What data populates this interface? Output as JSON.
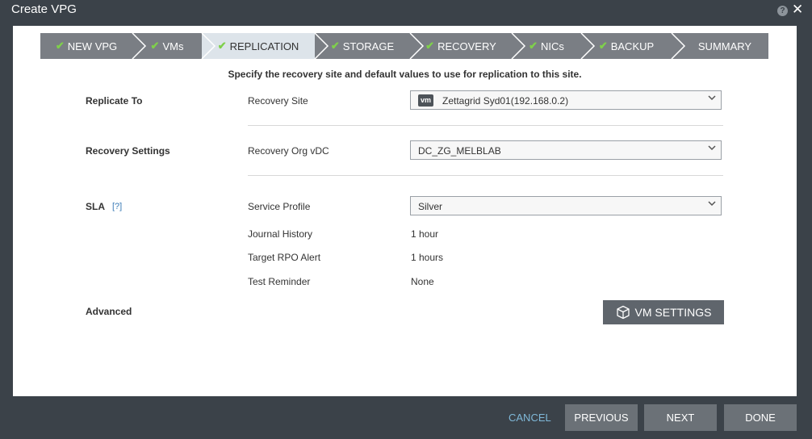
{
  "window": {
    "title": "Create VPG"
  },
  "wizard": {
    "steps": [
      {
        "label": "NEW VPG",
        "check": "✔"
      },
      {
        "label": "VMs",
        "check": "✔"
      },
      {
        "label": "REPLICATION",
        "check": "✔"
      },
      {
        "label": "STORAGE",
        "check": "✔"
      },
      {
        "label": "RECOVERY",
        "check": "✔"
      },
      {
        "label": "NICs",
        "check": "✔"
      },
      {
        "label": "BACKUP",
        "check": "✔"
      },
      {
        "label": "SUMMARY",
        "check": ""
      }
    ],
    "active_step": "REPLICATION"
  },
  "instructions": "Specify the recovery site and default values to use for replication to this site.",
  "replicate_to": {
    "section": "Replicate To",
    "label": "Recovery Site",
    "badge": "vm",
    "value": "Zettagrid Syd01(192.168.0.2)"
  },
  "recovery_settings": {
    "section": "Recovery Settings",
    "label": "Recovery Org vDC",
    "value": "DC_ZG_MELBLAB"
  },
  "sla": {
    "section": "SLA",
    "help": "[?]",
    "service_profile_label": "Service Profile",
    "service_profile_value": "Silver",
    "journal_history_label": "Journal History",
    "journal_history_value": "1 hour",
    "target_rpo_label": "Target RPO Alert",
    "target_rpo_value": "1 hours",
    "test_reminder_label": "Test Reminder",
    "test_reminder_value": "None"
  },
  "advanced": {
    "section": "Advanced",
    "vm_settings_label": "VM SETTINGS"
  },
  "footer": {
    "cancel": "CANCEL",
    "previous": "PREVIOUS",
    "next": "NEXT",
    "done": "DONE"
  },
  "colors": {
    "background": "#3b4249",
    "step_inactive": "#7a7e84",
    "step_active": "#dde4ea",
    "check": "#7fd04b",
    "link": "#7fb8d8",
    "button": "#6b7177"
  }
}
